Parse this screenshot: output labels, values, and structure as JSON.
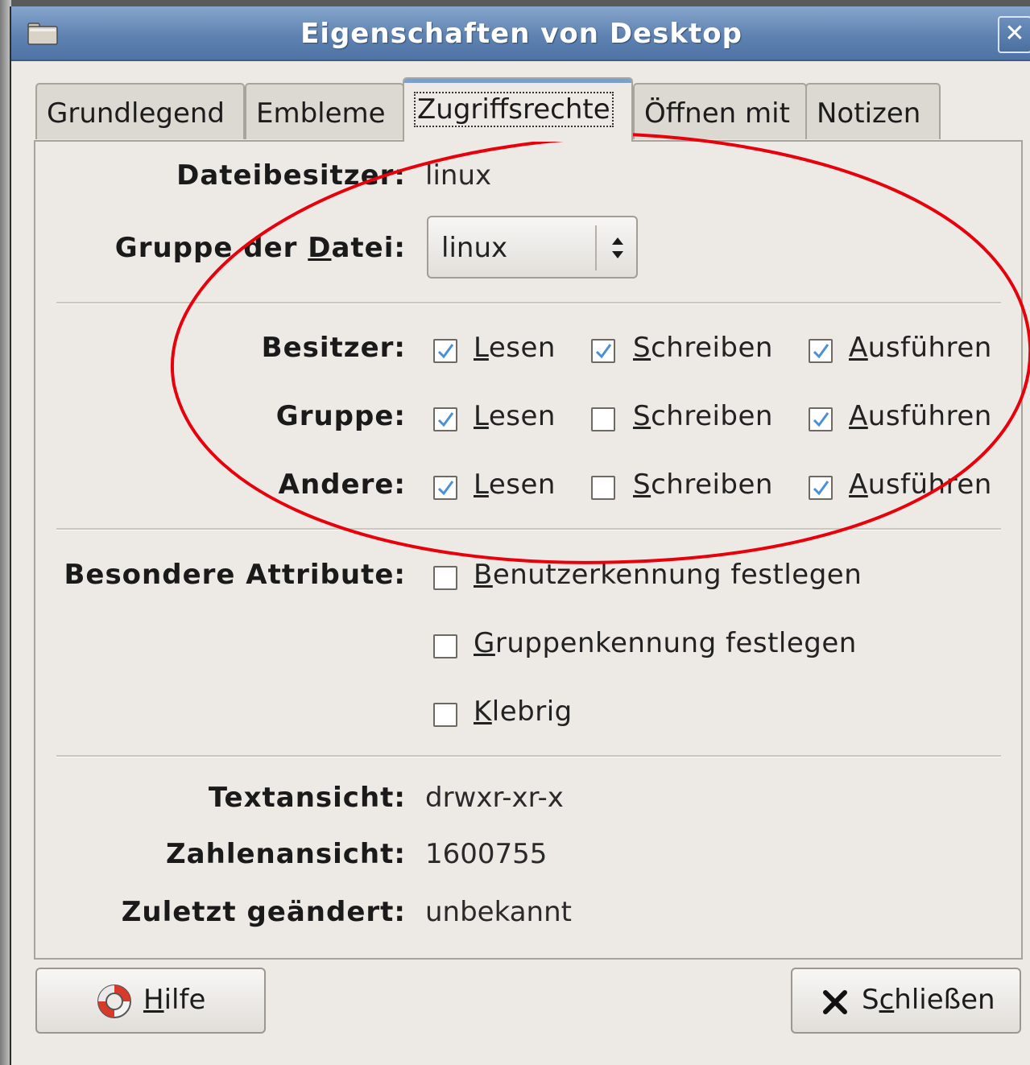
{
  "window": {
    "title": "Eigenschaften von Desktop",
    "close_glyph": "✕"
  },
  "tabs": [
    {
      "label": "Grundlegend",
      "active": false
    },
    {
      "label": "Embleme",
      "active": false
    },
    {
      "label": "Zugriffsrechte",
      "active": true
    },
    {
      "label": "Öffnen mit",
      "active": false
    },
    {
      "label": "Notizen",
      "active": false
    }
  ],
  "owner": {
    "label": "Dateibesitzer:",
    "value": "linux"
  },
  "group": {
    "label_pre": "Gruppe der ",
    "label_u": "D",
    "label_post": "atei:",
    "value": "linux"
  },
  "permissions": {
    "rows": [
      {
        "label": "Besitzer:",
        "read": true,
        "write": true,
        "execute": true
      },
      {
        "label": "Gruppe:",
        "read": true,
        "write": false,
        "execute": true
      },
      {
        "label": "Andere:",
        "read": true,
        "write": false,
        "execute": true
      }
    ],
    "read_u": "L",
    "read_rest": "esen",
    "write_u": "S",
    "write_rest": "chreiben",
    "exec_u": "A",
    "exec_rest": "usführen"
  },
  "special": {
    "label": "Besondere Attribute:",
    "items": [
      {
        "u": "B",
        "rest": "enutzerkennung festlegen",
        "checked": false
      },
      {
        "u": "G",
        "rest": "ruppenkennung festlegen",
        "checked": false
      },
      {
        "u": "K",
        "rest": "lebrig",
        "checked": false
      }
    ]
  },
  "text_view": {
    "label": "Textansicht:",
    "value": "drwxr-xr-x"
  },
  "number_view": {
    "label": "Zahlenansicht:",
    "value": "1600755"
  },
  "last_changed": {
    "label": "Zuletzt geändert:",
    "value": "unbekannt"
  },
  "buttons": {
    "help_u": "H",
    "help_rest": "ilfe",
    "close_pre": "S",
    "close_u": "c",
    "close_rest": "hließen"
  },
  "annotation_color": "#e8000b",
  "check_color": "#4a90d9"
}
